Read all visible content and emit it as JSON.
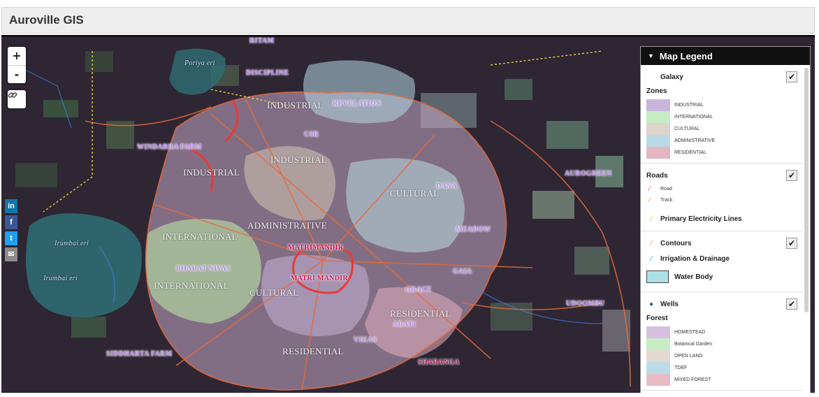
{
  "app": {
    "title": "Auroville GIS"
  },
  "map_controls": {
    "zoom_in": "+",
    "zoom_out": "-",
    "link_icon": "link-icon"
  },
  "share": {
    "linkedin": "in",
    "facebook": "f",
    "twitter": "t",
    "mail": "✉"
  },
  "map_labels": {
    "industrial_1": "INDUSTRIAL",
    "industrial_2": "INDUSTRIAL",
    "industrial_3": "INDUSTRIAL",
    "international_1": "INTERNATIONAL",
    "international_2": "INTERNATIONAL",
    "administrative": "ADMINISTRATIVE",
    "cultural_1": "CULTURAL",
    "cultural_2": "CULTURAL",
    "residential_1": "RESIDENTIAL",
    "residential_2": "RESIDENTIAL",
    "windarra": "WINDARRA FARM",
    "siddharta": "SIDDHARTA FARM",
    "aurogreen": "AUROGREEN",
    "udoombu": "UDOOMBU",
    "discipline": "DISCIPLINE",
    "revelation": "REVELATION",
    "ritam": "RITAM",
    "csr": "CSR",
    "matri_1": "MATRIMANDIR",
    "matri_2": "MATRI MANDIR",
    "grace": "GRACE",
    "gaia": "GAIA",
    "meadow": "MEADOW",
    "aratt": "ARATI",
    "vikas": "VIKAS",
    "sharanga": "SHARANGA",
    "bharat_nivas": "BHARAT NIVAS",
    "dana": "DANA",
    "porisa_eri": "Poriya eri",
    "irumbai_eri_1": "Irumbai eri",
    "irumbai_eri_2": "Irumbai eri"
  },
  "legend": {
    "title": "Map Legend",
    "galaxy": "Galaxy",
    "zones_heading": "Zones",
    "zones": [
      {
        "label": "INDUSTRIAL",
        "color": "#c9b5d9"
      },
      {
        "label": "INTERNATIONAL",
        "color": "#c6ecc4"
      },
      {
        "label": "CULTURAL",
        "color": "#dcd3cc"
      },
      {
        "label": "ADMINISTRATIVE",
        "color": "#b8d9e6"
      },
      {
        "label": "RESIDENTIAL",
        "color": "#e3b5c0"
      }
    ],
    "roads_heading": "Roads",
    "road": "Road",
    "track": "Track",
    "electricity": "Primary Electricity Lines",
    "contours": "Contours",
    "irrigation": "Irrigation & Drainage",
    "water_body": "Water Body",
    "wells": "Wells",
    "forest_heading": "Forest",
    "forest": [
      {
        "label": "HOMESTEAD",
        "color": "#d6bfe0"
      },
      {
        "label": "Botanical Garden",
        "color": "#c6ecc4"
      },
      {
        "label": "OPEN LAND",
        "color": "#e2dad2"
      },
      {
        "label": "TDEF",
        "color": "#bcdbe8"
      },
      {
        "label": "MIXED FOREST",
        "color": "#e7bcc6"
      }
    ],
    "check": "✔"
  }
}
